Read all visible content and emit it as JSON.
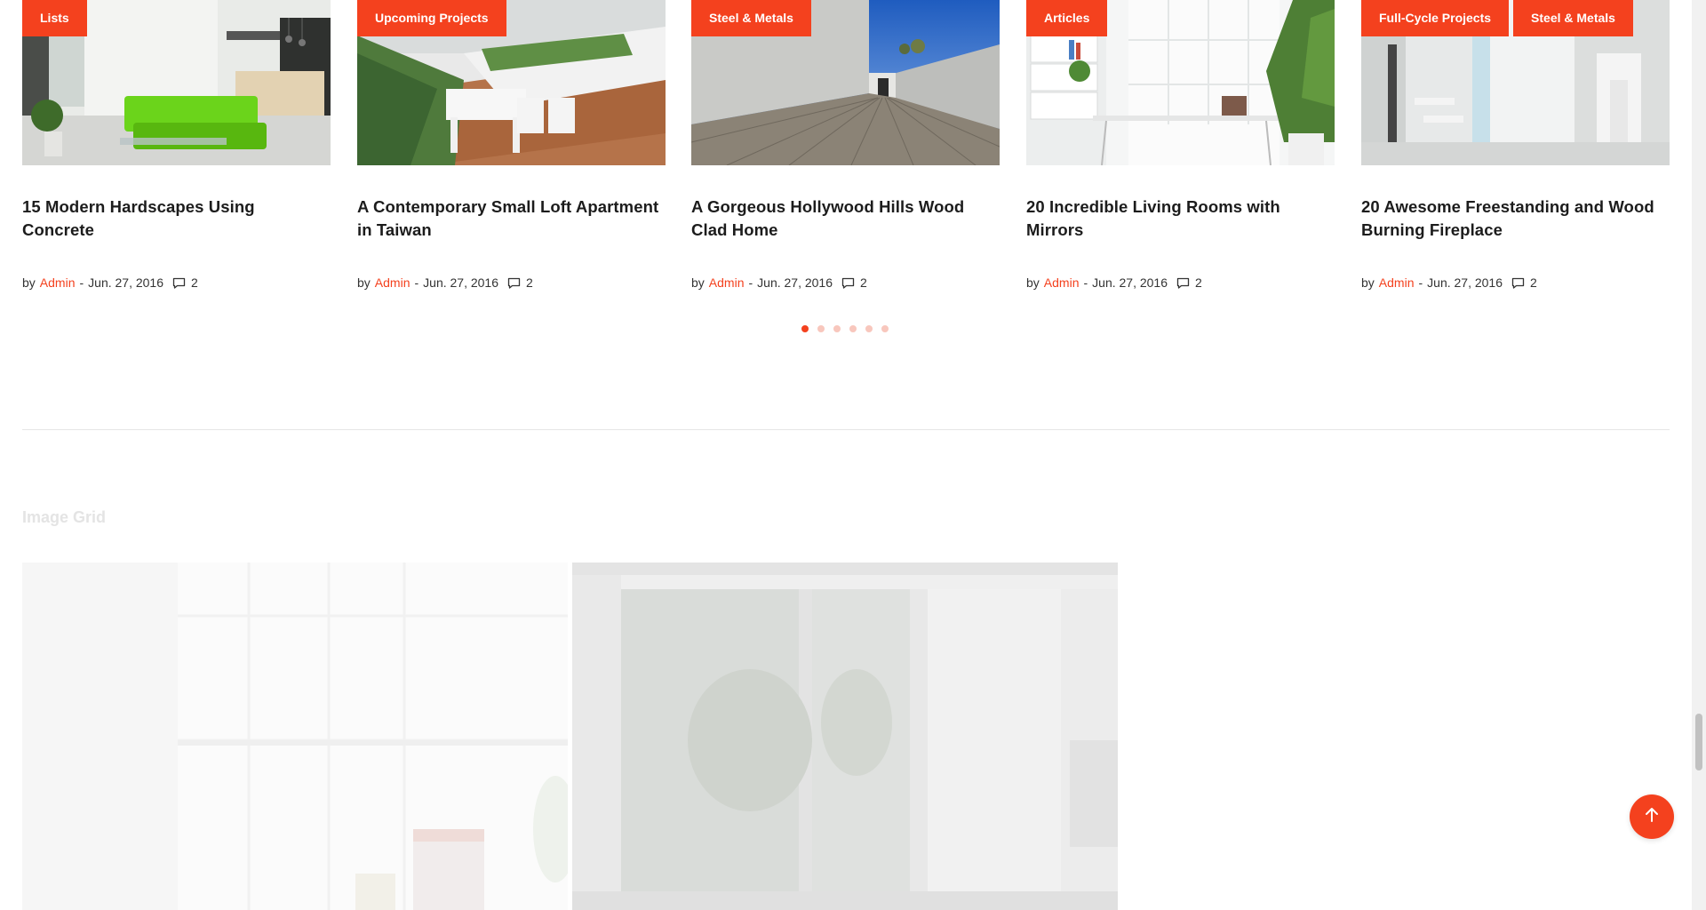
{
  "posts": [
    {
      "tags": [
        "Lists"
      ],
      "title": "15 Modern Hardscapes Using Concrete",
      "by": "by",
      "author": "Admin",
      "date": "Jun. 27, 2016",
      "comments": "2",
      "image_icon": "living-room-image"
    },
    {
      "tags": [
        "Upcoming Projects"
      ],
      "title": "A Contemporary Small Loft Apartment in Taiwan",
      "by": "by",
      "author": "Admin",
      "date": "Jun. 27, 2016",
      "comments": "2",
      "image_icon": "terrace-image"
    },
    {
      "tags": [
        "Steel & Metals"
      ],
      "title": "A Gorgeous Hollywood Hills Wood Clad Home",
      "by": "by",
      "author": "Admin",
      "date": "Jun. 27, 2016",
      "comments": "2",
      "image_icon": "concrete-deck-image"
    },
    {
      "tags": [
        "Articles"
      ],
      "title": "20 Incredible Living Rooms with Mirrors",
      "by": "by",
      "author": "Admin",
      "date": "Jun. 27, 2016",
      "comments": "2",
      "image_icon": "office-desk-image"
    },
    {
      "tags": [
        "Full-Cycle Projects",
        "Steel & Metals"
      ],
      "title": "20 Awesome Freestanding and Wood Burning Fireplace",
      "by": "by",
      "author": "Admin",
      "date": "Jun. 27, 2016",
      "comments": "2",
      "image_icon": "white-interior-image"
    }
  ],
  "carousel": {
    "page_count": 6,
    "active_index": 0
  },
  "image_grid": {
    "title": "Image Grid"
  },
  "colors": {
    "accent": "#f4411e",
    "dot_inactive": "#f8c7bd",
    "divider": "#e6e6e6"
  },
  "icons": {
    "comment": "comment-icon",
    "back_to_top": "arrow-up-icon"
  }
}
